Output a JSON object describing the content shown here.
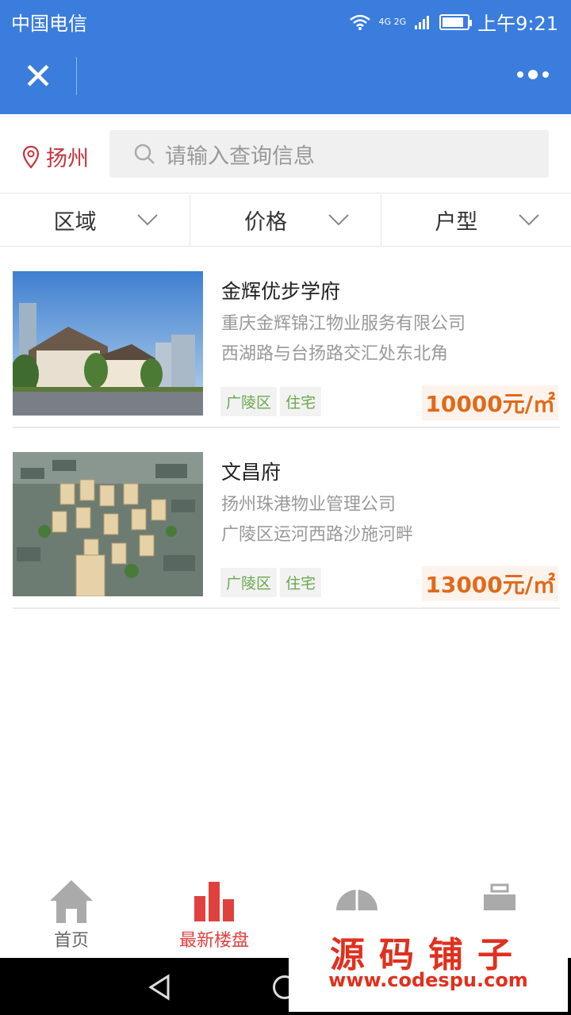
{
  "status": {
    "carrier": "中国电信",
    "network": "4G 2G",
    "time": "上午9:21"
  },
  "header": {
    "close_icon": "close-icon",
    "more_icon": "more-dots-icon"
  },
  "search": {
    "city": "扬州",
    "placeholder": "请输入查询信息"
  },
  "filters": [
    {
      "label": "区域"
    },
    {
      "label": "价格"
    },
    {
      "label": "户型"
    }
  ],
  "listings": [
    {
      "name": "金辉优步学府",
      "company": "重庆金辉锦江物业服务有限公司",
      "address": "西湖路与台扬路交汇处东北角",
      "tags": [
        "广陵区",
        "住宅"
      ],
      "price": "10000元/㎡"
    },
    {
      "name": "文昌府",
      "company": "扬州珠港物业管理公司",
      "address": "广陵区运河西路沙施河畔",
      "tags": [
        "广陵区",
        "住宅"
      ],
      "price": "13000元/㎡"
    }
  ],
  "tabbar": {
    "tabs": [
      {
        "label": "首页",
        "icon": "home-icon"
      },
      {
        "label": "最新楼盘",
        "icon": "bar-chart-icon",
        "active": true
      },
      {
        "label": "",
        "icon": "pie-icon"
      },
      {
        "label": "",
        "icon": "briefcase-icon"
      }
    ]
  },
  "watermark": {
    "title": "源码铺子",
    "url": "www.codespu.com"
  },
  "colors": {
    "primary": "#3b7ddd",
    "accent": "#e0413f",
    "price": "#e06a1b",
    "tag": "#6aa84f"
  }
}
